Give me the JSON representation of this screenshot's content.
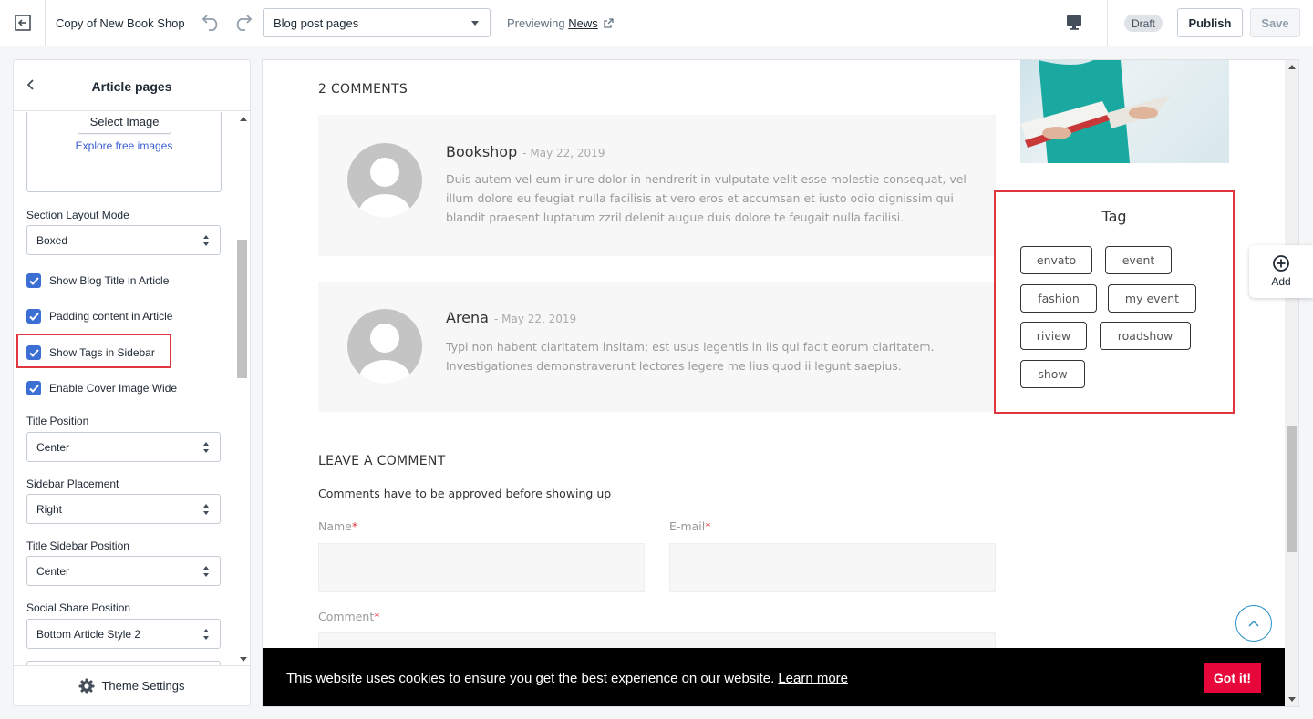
{
  "topbar": {
    "theme_name": "Copy of New Book Shop",
    "page_select": "Blog post pages",
    "previewing_label": "Previewing",
    "previewing_link": "News",
    "status": "Draft",
    "publish": "Publish",
    "save": "Save"
  },
  "sidebar": {
    "title": "Article pages",
    "select_image": "Select Image",
    "explore_images": "Explore free images",
    "section_layout_label": "Section Layout Mode",
    "section_layout_value": "Boxed",
    "checks": [
      {
        "label": "Show Blog Title in Article",
        "checked": true
      },
      {
        "label": "Padding content in Article",
        "checked": true
      },
      {
        "label": "Show Tags in Sidebar",
        "checked": true
      },
      {
        "label": "Enable Cover Image Wide",
        "checked": true
      }
    ],
    "title_position_label": "Title Position",
    "title_position_value": "Center",
    "sidebar_placement_label": "Sidebar Placement",
    "sidebar_placement_value": "Right",
    "title_sidebar_position_label": "Title Sidebar Position",
    "title_sidebar_position_value": "Center",
    "social_share_label": "Social Share Position",
    "social_share_value": "Bottom Article Style 2",
    "footer": "Theme Settings"
  },
  "preview": {
    "comments_title": "2 COMMENTS",
    "comments": [
      {
        "author": "Bookshop",
        "date": "- May 22, 2019",
        "text": "Duis autem vel eum iriure dolor in hendrerit in vulputate velit esse molestie consequat, vel illum dolore eu feugiat nulla facilisis at vero eros et accumsan et iusto odio dignissim qui blandit praesent luptatum zzril delenit augue duis dolore te feugait nulla facilisi."
      },
      {
        "author": "Arena",
        "date": "- May 22, 2019",
        "text": "Typi non habent claritatem insitam; est usus legentis in iis qui facit eorum claritatem. Investigationes demonstraverunt lectores legere me lius quod ii legunt saepius."
      }
    ],
    "tag_title": "Tag",
    "tags": [
      "envato",
      "event",
      "fashion",
      "my event",
      "riview",
      "roadshow",
      "show"
    ],
    "leave_comment_title": "LEAVE A COMMENT",
    "approval_note": "Comments have to be approved before showing up",
    "name_label": "Name",
    "email_label": "E-mail",
    "comment_label": "Comment",
    "required_mark": "*",
    "add_label": "Add",
    "cookie_message": "This website uses cookies to ensure you get the best experience on our website.",
    "cookie_learn_more": "Learn more",
    "cookie_button": "Got it!"
  },
  "colors": {
    "accent": "#3c6fd3",
    "highlight": "#e0373f",
    "cookie_button": "#e8073a"
  }
}
